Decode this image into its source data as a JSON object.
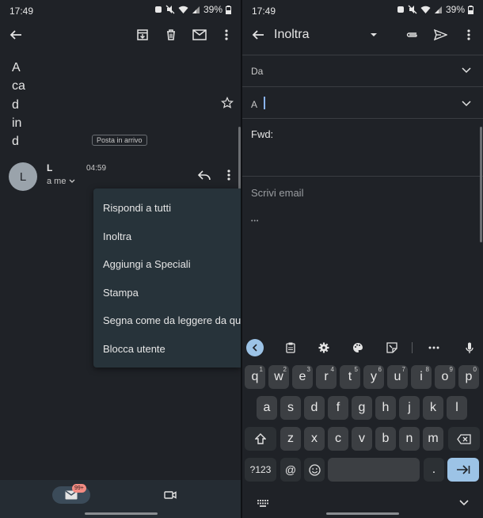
{
  "left": {
    "status": {
      "time": "17:49",
      "battery": "39%"
    },
    "subject_letters": [
      "A",
      "ca",
      "d",
      "in",
      "d"
    ],
    "label_badge": "Posta in arrivo",
    "sender": {
      "avatar_letter": "L",
      "name": "L",
      "time": "04:59",
      "to": "a me"
    },
    "menu": [
      "Rispondi a tutti",
      "Inoltra",
      "Aggiungi a Speciali",
      "Stampa",
      "Segna come da leggere da qui",
      "Blocca utente"
    ],
    "bottom": {
      "badge": "99+"
    }
  },
  "right": {
    "status": {
      "time": "17:49",
      "battery": "39%"
    },
    "title": "Inoltra",
    "from_label": "Da",
    "to_label": "A",
    "subject": "Fwd:",
    "body_placeholder": "Scrivi email",
    "ellipsis": "•••",
    "keyboard": {
      "row1": [
        {
          "k": "q",
          "s": "1"
        },
        {
          "k": "w",
          "s": "2"
        },
        {
          "k": "e",
          "s": "3"
        },
        {
          "k": "r",
          "s": "4"
        },
        {
          "k": "t",
          "s": "5"
        },
        {
          "k": "y",
          "s": "6"
        },
        {
          "k": "u",
          "s": "7"
        },
        {
          "k": "i",
          "s": "8"
        },
        {
          "k": "o",
          "s": "9"
        },
        {
          "k": "p",
          "s": "0"
        }
      ],
      "row2": [
        "a",
        "s",
        "d",
        "f",
        "g",
        "h",
        "j",
        "k",
        "l"
      ],
      "row3": [
        "z",
        "x",
        "c",
        "v",
        "b",
        "n",
        "m"
      ],
      "symbols": "?123",
      "at": "@",
      "period": "."
    }
  }
}
